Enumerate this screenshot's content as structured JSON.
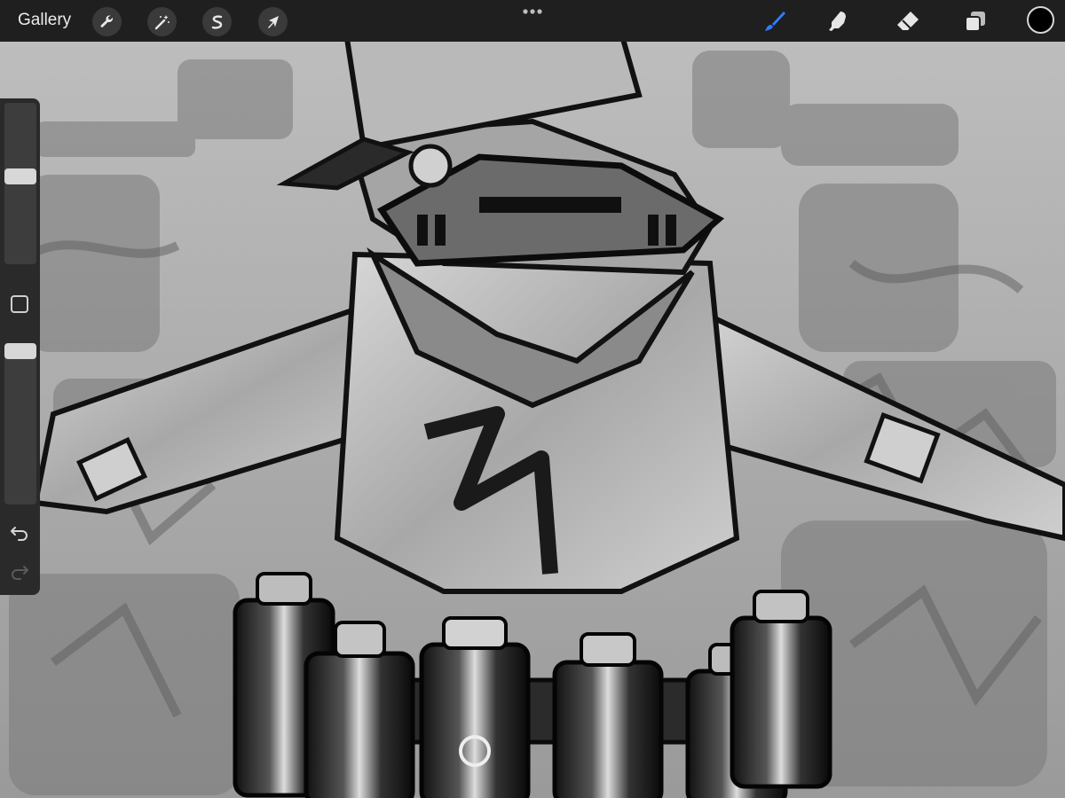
{
  "app": {
    "gallery_label": "Gallery"
  },
  "toolbar": {
    "left_tools": [
      {
        "name": "actions",
        "icon": "wrench-icon"
      },
      {
        "name": "adjustments",
        "icon": "magic-wand-icon"
      },
      {
        "name": "selection",
        "icon": "selection-s-icon"
      },
      {
        "name": "transform",
        "icon": "arrow-cursor-icon"
      }
    ],
    "center_menu_icon": "more-dots-icon",
    "right_tools": [
      {
        "name": "brush",
        "icon": "paintbrush-icon",
        "active": true
      },
      {
        "name": "smudge",
        "icon": "smudge-finger-icon",
        "active": false
      },
      {
        "name": "eraser",
        "icon": "eraser-icon",
        "active": false
      },
      {
        "name": "layers",
        "icon": "layers-icon",
        "active": false
      }
    ],
    "current_color": "#000000",
    "active_tool_color": "#2f7dff"
  },
  "sidebar": {
    "brush_size_level": 0.45,
    "opacity_level": 0.0,
    "modify_button_icon": "square-modify-icon",
    "undo_icon": "undo-icon",
    "redo_icon": "redo-icon"
  },
  "canvas": {
    "description_icon": "artwork-canvas",
    "background_color": "#8e8e8e"
  }
}
